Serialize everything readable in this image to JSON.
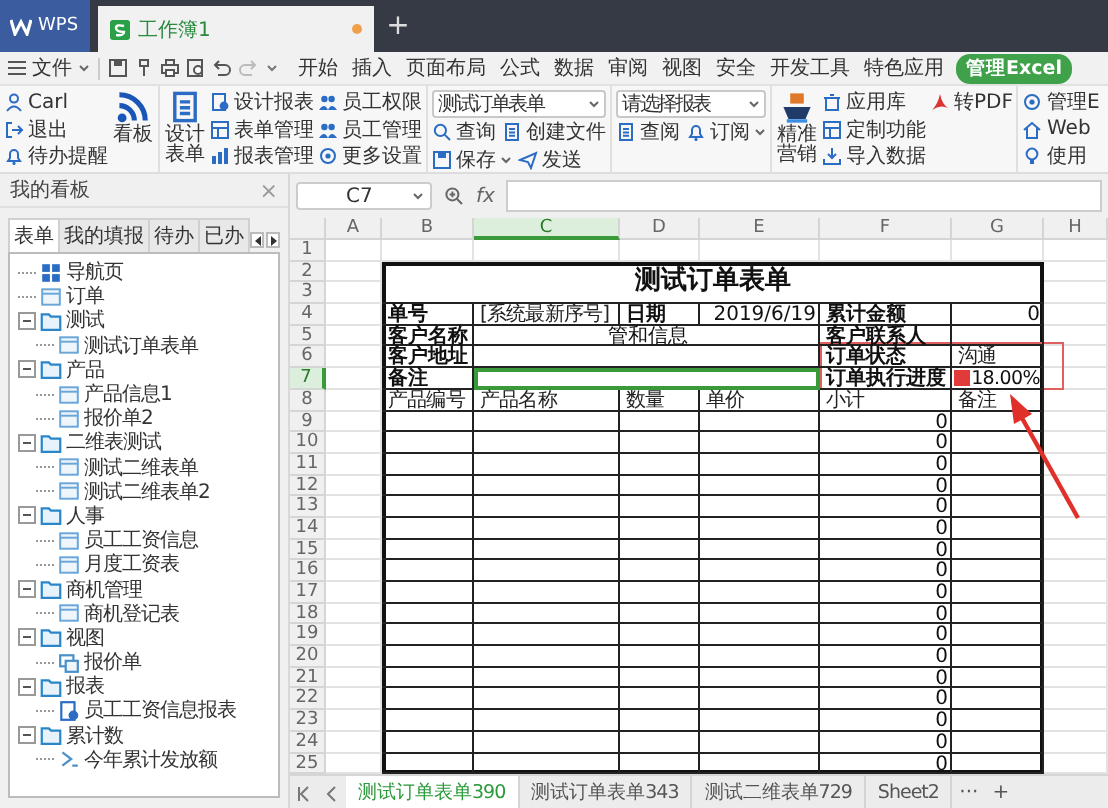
{
  "title_bar": {
    "app_tab": "WPS",
    "tabs": [
      {
        "label": "工作簿1",
        "selected": true,
        "unsaved": true
      }
    ],
    "new_tab": "+"
  },
  "menu": {
    "file": "文件",
    "tabs": [
      {
        "label": "开始",
        "selected": false
      },
      {
        "label": "插入",
        "selected": false
      },
      {
        "label": "页面布局",
        "selected": false
      },
      {
        "label": "公式",
        "selected": false
      },
      {
        "label": "数据",
        "selected": false
      },
      {
        "label": "审阅",
        "selected": false
      },
      {
        "label": "视图",
        "selected": false
      },
      {
        "label": "安全",
        "selected": false
      },
      {
        "label": "开发工具",
        "selected": false
      },
      {
        "label": "特色应用",
        "selected": false
      },
      {
        "label": "管理Excel",
        "selected": true
      }
    ]
  },
  "ribbon": {
    "groups": [
      {
        "parts": [
          {
            "kind": "stack",
            "items": [
              {
                "label": "Carl",
                "kind": "person"
              },
              {
                "label": "退出",
                "kind": "exit"
              },
              {
                "label": "待办提醒",
                "kind": "bell"
              }
            ]
          },
          {
            "kind": "large",
            "item": {
              "label": "看板",
              "kind": "rss"
            }
          }
        ]
      },
      {
        "parts": [
          {
            "kind": "large",
            "item": {
              "label": "设计表单",
              "kind": "document"
            }
          },
          {
            "kind": "stack",
            "items": [
              {
                "label": "设计报表",
                "kind": "report"
              },
              {
                "label": "表单管理",
                "kind": "table"
              },
              {
                "label": "报表管理",
                "kind": "chart"
              }
            ]
          },
          {
            "kind": "stack",
            "items": [
              {
                "label": "员工权限",
                "kind": "people"
              },
              {
                "label": "员工管理",
                "kind": "people"
              },
              {
                "label": "更多设置",
                "kind": "gear"
              }
            ]
          }
        ]
      },
      {
        "parts": [
          {
            "kind": "combo",
            "dropdown": "测试订单表单",
            "rows": [
              [
                {
                  "label": "查询",
                  "kind": "search"
                },
                {
                  "label": "创建文件",
                  "kind": "document"
                }
              ],
              [
                {
                  "label": "保存",
                  "kind": "save",
                  "menu": true
                },
                {
                  "label": "发送",
                  "kind": "send"
                }
              ]
            ]
          }
        ]
      },
      {
        "parts": [
          {
            "kind": "combo",
            "dropdown": "请选择报表",
            "rows": [
              [
                {
                  "label": "查阅",
                  "kind": "document"
                },
                {
                  "label": "订阅",
                  "kind": "bell",
                  "menu": true
                }
              ]
            ]
          }
        ]
      },
      {
        "parts": [
          {
            "kind": "large",
            "item": {
              "label": "精准营销",
              "kind": "ship"
            }
          },
          {
            "kind": "stack",
            "items": [
              {
                "label": "应用库",
                "kind": "box"
              },
              {
                "label": "定制功能",
                "kind": "table"
              },
              {
                "label": "导入数据",
                "kind": "import"
              }
            ]
          },
          {
            "kind": "stack",
            "items": [
              {
                "label": "转PDF",
                "kind": "pdf"
              }
            ]
          }
        ]
      },
      {
        "parts": [
          {
            "kind": "stack",
            "items": [
              {
                "label": "管理E",
                "kind": "gear"
              },
              {
                "label": "Web",
                "kind": "home"
              },
              {
                "label": "使用",
                "kind": "bulb"
              }
            ]
          }
        ]
      }
    ]
  },
  "sidebar": {
    "title": "我的看板",
    "close": "×",
    "tabs": [
      {
        "label": "表单",
        "selected": true
      },
      {
        "label": "我的填报",
        "selected": false
      },
      {
        "label": "待办",
        "selected": false
      },
      {
        "label": "已办",
        "selected": false
      }
    ],
    "tree": [
      {
        "label": "导航页",
        "kind": "nav"
      },
      {
        "label": "订单",
        "kind": "form"
      },
      {
        "label": "测试",
        "kind": "folder",
        "expanded": true,
        "children": [
          {
            "label": "测试订单表单",
            "kind": "form"
          }
        ]
      },
      {
        "label": "产品",
        "kind": "folder",
        "expanded": true,
        "children": [
          {
            "label": "产品信息1",
            "kind": "form"
          },
          {
            "label": "报价单2",
            "kind": "form"
          }
        ]
      },
      {
        "label": "二维表测试",
        "kind": "folder",
        "expanded": true,
        "children": [
          {
            "label": "测试二维表单",
            "kind": "form"
          },
          {
            "label": "测试二维表单2",
            "kind": "form"
          }
        ]
      },
      {
        "label": "人事",
        "kind": "folder",
        "expanded": true,
        "children": [
          {
            "label": "员工工资信息",
            "kind": "form"
          },
          {
            "label": "月度工资表",
            "kind": "form"
          }
        ]
      },
      {
        "label": "商机管理",
        "kind": "folder",
        "expanded": true,
        "children": [
          {
            "label": "商机登记表",
            "kind": "form"
          }
        ]
      },
      {
        "label": "视图",
        "kind": "folder",
        "expanded": true,
        "children": [
          {
            "label": "报价单",
            "kind": "view"
          }
        ]
      },
      {
        "label": "报表",
        "kind": "folder",
        "expanded": true,
        "children": [
          {
            "label": "员工工资信息报表",
            "kind": "report"
          }
        ]
      },
      {
        "label": "累计数",
        "kind": "folder",
        "expanded": true,
        "children": [
          {
            "label": "今年累计发放额",
            "kind": "sum"
          }
        ]
      }
    ]
  },
  "sheet": {
    "name_box": "C7",
    "fx": "fx",
    "columns": [
      {
        "label": "A",
        "selected": false
      },
      {
        "label": "B",
        "selected": false
      },
      {
        "label": "C",
        "selected": true
      },
      {
        "label": "D",
        "selected": false
      },
      {
        "label": "E",
        "selected": false
      },
      {
        "label": "F",
        "selected": false
      },
      {
        "label": "G",
        "selected": false
      },
      {
        "label": "H",
        "selected": false
      }
    ],
    "rows": [
      {
        "label": "1",
        "selected": false
      },
      {
        "label": "2",
        "selected": false
      },
      {
        "label": "3",
        "selected": false
      },
      {
        "label": "4",
        "selected": false
      },
      {
        "label": "5",
        "selected": false
      },
      {
        "label": "6",
        "selected": false
      },
      {
        "label": "7",
        "selected": true
      },
      {
        "label": "8",
        "selected": false
      },
      {
        "label": "9",
        "selected": false
      },
      {
        "label": "10",
        "selected": false
      },
      {
        "label": "11",
        "selected": false
      },
      {
        "label": "12",
        "selected": false
      },
      {
        "label": "13",
        "selected": false
      },
      {
        "label": "14",
        "selected": false
      },
      {
        "label": "15",
        "selected": false
      },
      {
        "label": "16",
        "selected": false
      },
      {
        "label": "17",
        "selected": false
      },
      {
        "label": "18",
        "selected": false
      },
      {
        "label": "19",
        "selected": false
      },
      {
        "label": "20",
        "selected": false
      },
      {
        "label": "21",
        "selected": false
      },
      {
        "label": "22",
        "selected": false
      },
      {
        "label": "23",
        "selected": false
      },
      {
        "label": "24",
        "selected": false
      },
      {
        "label": "25",
        "selected": false
      }
    ],
    "title": "测试订单表单",
    "form_rows": [
      {
        "cells": [
          {
            "kind": "label",
            "text": "单号",
            "selected": false
          },
          {
            "kind": "value",
            "text": "[系统最新序号]",
            "selected": false
          },
          {
            "kind": "label",
            "text": "日期",
            "selected": false
          },
          {
            "kind": "number",
            "text": "2019/6/19",
            "selected": false
          },
          {
            "kind": "label",
            "text": "累计金额",
            "selected": false
          },
          {
            "kind": "number",
            "text": "0",
            "selected": false
          }
        ]
      },
      {
        "cells": [
          {
            "kind": "label",
            "text": "客户名称",
            "selected": false
          },
          {
            "kind": "merged",
            "text": "管和信息",
            "selected": false
          },
          {
            "kind": "label",
            "text": "客户联系人",
            "selected": false
          },
          {
            "kind": "blank",
            "selected": false
          }
        ]
      },
      {
        "cells": [
          {
            "kind": "label",
            "text": "客户地址",
            "selected": false
          },
          {
            "kind": "merged_blank",
            "selected": false
          },
          {
            "kind": "label",
            "text": "订单状态",
            "selected": false
          },
          {
            "kind": "value",
            "text": "沟通",
            "selected": false
          }
        ]
      },
      {
        "cells": [
          {
            "kind": "label",
            "text": "备注",
            "selected": false
          },
          {
            "kind": "merged_blank",
            "selected": true
          },
          {
            "kind": "label",
            "text": "订单执行进度",
            "selected": false
          },
          {
            "kind": "progress",
            "text": "18.00%",
            "level": 0.18,
            "selected": false
          }
        ]
      },
      {
        "cells": [
          {
            "kind": "value",
            "text": "产品编号",
            "selected": false
          },
          {
            "kind": "value",
            "text": "产品名称",
            "selected": false
          },
          {
            "kind": "value",
            "text": "数量",
            "selected": false
          },
          {
            "kind": "value",
            "text": "单价",
            "selected": false
          },
          {
            "kind": "value",
            "text": "小计",
            "selected": false
          },
          {
            "kind": "value",
            "text": "备注",
            "selected": false
          }
        ]
      }
    ],
    "item_rows": [
      {
        "subtotal": "0"
      },
      {
        "subtotal": "0"
      },
      {
        "subtotal": "0"
      },
      {
        "subtotal": "0"
      },
      {
        "subtotal": "0"
      },
      {
        "subtotal": "0"
      },
      {
        "subtotal": "0"
      },
      {
        "subtotal": "0"
      },
      {
        "subtotal": "0"
      },
      {
        "subtotal": "0"
      },
      {
        "subtotal": "0"
      },
      {
        "subtotal": "0"
      },
      {
        "subtotal": "0"
      },
      {
        "subtotal": "0"
      },
      {
        "subtotal": "0"
      },
      {
        "subtotal": "0"
      },
      {
        "subtotal": "0"
      }
    ],
    "tabs": [
      {
        "label": "测试订单表单390",
        "selected": true
      },
      {
        "label": "测试订单表单343",
        "selected": false
      },
      {
        "label": "测试二维表单729",
        "selected": false
      },
      {
        "label": "Sheet2",
        "selected": false
      }
    ],
    "more": "···",
    "add": "+"
  }
}
